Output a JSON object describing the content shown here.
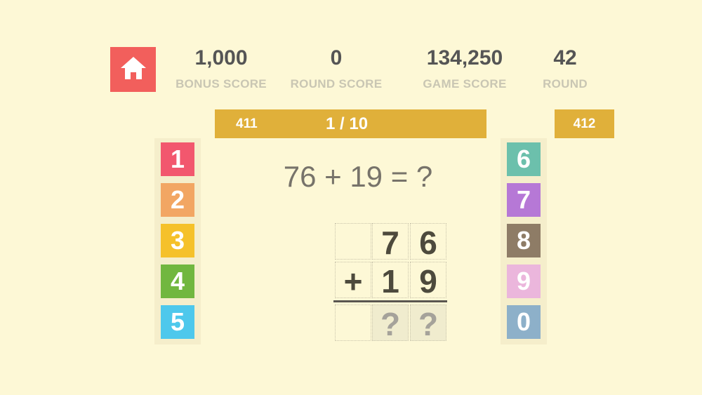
{
  "stats": {
    "bonus_score": {
      "value": "1,000",
      "label": "BONUS SCORE"
    },
    "round_score": {
      "value": "0",
      "label": "ROUND SCORE"
    },
    "game_score": {
      "value": "134,250",
      "label": "GAME SCORE"
    },
    "round": {
      "value": "42",
      "label": "ROUND"
    }
  },
  "progress_bar": {
    "previous_round": "411",
    "progress_text": "1 / 10",
    "next_round": "412"
  },
  "equation": "76 + 19 = ?",
  "keypad": {
    "left": [
      {
        "label": "1",
        "color": "#f2576e"
      },
      {
        "label": "2",
        "color": "#f2a663"
      },
      {
        "label": "3",
        "color": "#f5c12a"
      },
      {
        "label": "4",
        "color": "#71b73f"
      },
      {
        "label": "5",
        "color": "#4ec8ec"
      }
    ],
    "right": [
      {
        "label": "6",
        "color": "#6cc0ac"
      },
      {
        "label": "7",
        "color": "#b678d6"
      },
      {
        "label": "8",
        "color": "#8e7c66"
      },
      {
        "label": "9",
        "color": "#ebb6dc"
      },
      {
        "label": "0",
        "color": "#8db0c9"
      }
    ]
  },
  "grid": {
    "row1": [
      "",
      "7",
      "6"
    ],
    "row2": [
      "+",
      "1",
      "9"
    ],
    "answer": [
      "",
      "?",
      "?"
    ]
  },
  "icons": {
    "home": "home-icon"
  },
  "colors": {
    "background": "#fdf8d6",
    "home_button": "#f25f5c",
    "bar": "#e0b03a"
  }
}
